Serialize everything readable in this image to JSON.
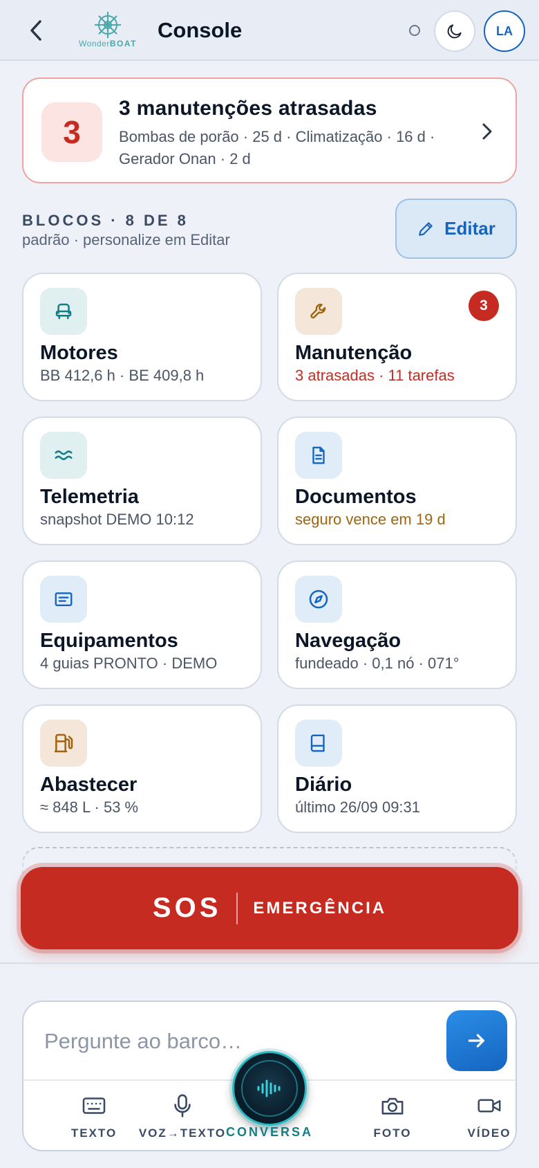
{
  "header": {
    "title": "Console",
    "logo_word1": "Wonder",
    "logo_word2": "BOAT",
    "avatar_initials": "LA"
  },
  "alert": {
    "count": "3",
    "title": "3 manutenções atrasadas",
    "detail": "Bombas de porão · 25 d · Climatização · 16 d · Gerador Onan · 2 d"
  },
  "blocks": {
    "heading": "BLOCOS · 8 DE 8",
    "subtitle": "padrão · personalize em Editar",
    "edit_label": "Editar"
  },
  "tiles": [
    {
      "title": "Motores",
      "subtitle": "BB 412,6 h · BE 409,8 h",
      "icon": "engine-icon"
    },
    {
      "title": "Manutenção",
      "subtitle": "3 atrasadas · 11 tarefas",
      "icon": "wrench-icon",
      "badge": "3"
    },
    {
      "title": "Telemetria",
      "subtitle": "snapshot DEMO 10:12",
      "icon": "waves-icon"
    },
    {
      "title": "Documentos",
      "subtitle": "seguro vence em 19 d",
      "icon": "document-icon"
    },
    {
      "title": "Equipamentos",
      "subtitle": "4 guias PRONTO · DEMO",
      "icon": "manual-icon"
    },
    {
      "title": "Navegação",
      "subtitle": "fundeado · 0,1 nó · 071°",
      "icon": "compass-icon"
    },
    {
      "title": "Abastecer",
      "subtitle": "≈ 848 L · 53 %",
      "icon": "fuel-pump-icon"
    },
    {
      "title": "Diário",
      "subtitle": "último 26/09 09:31",
      "icon": "book-icon"
    }
  ],
  "sos": {
    "label": "SOS",
    "sublabel": "EMERGÊNCIA"
  },
  "composer": {
    "placeholder": "Pergunte ao barco…",
    "actions": {
      "text": "TEXTO",
      "voice": "VOZ→TEXTO",
      "conversation": "CONVERSA",
      "photo": "FOTO",
      "video": "VÍDEO"
    }
  },
  "colors": {
    "accent_blue": "#1565c0",
    "alert_red": "#c62b22",
    "warning_amber": "#a0640f",
    "teal": "#26b9c4"
  }
}
